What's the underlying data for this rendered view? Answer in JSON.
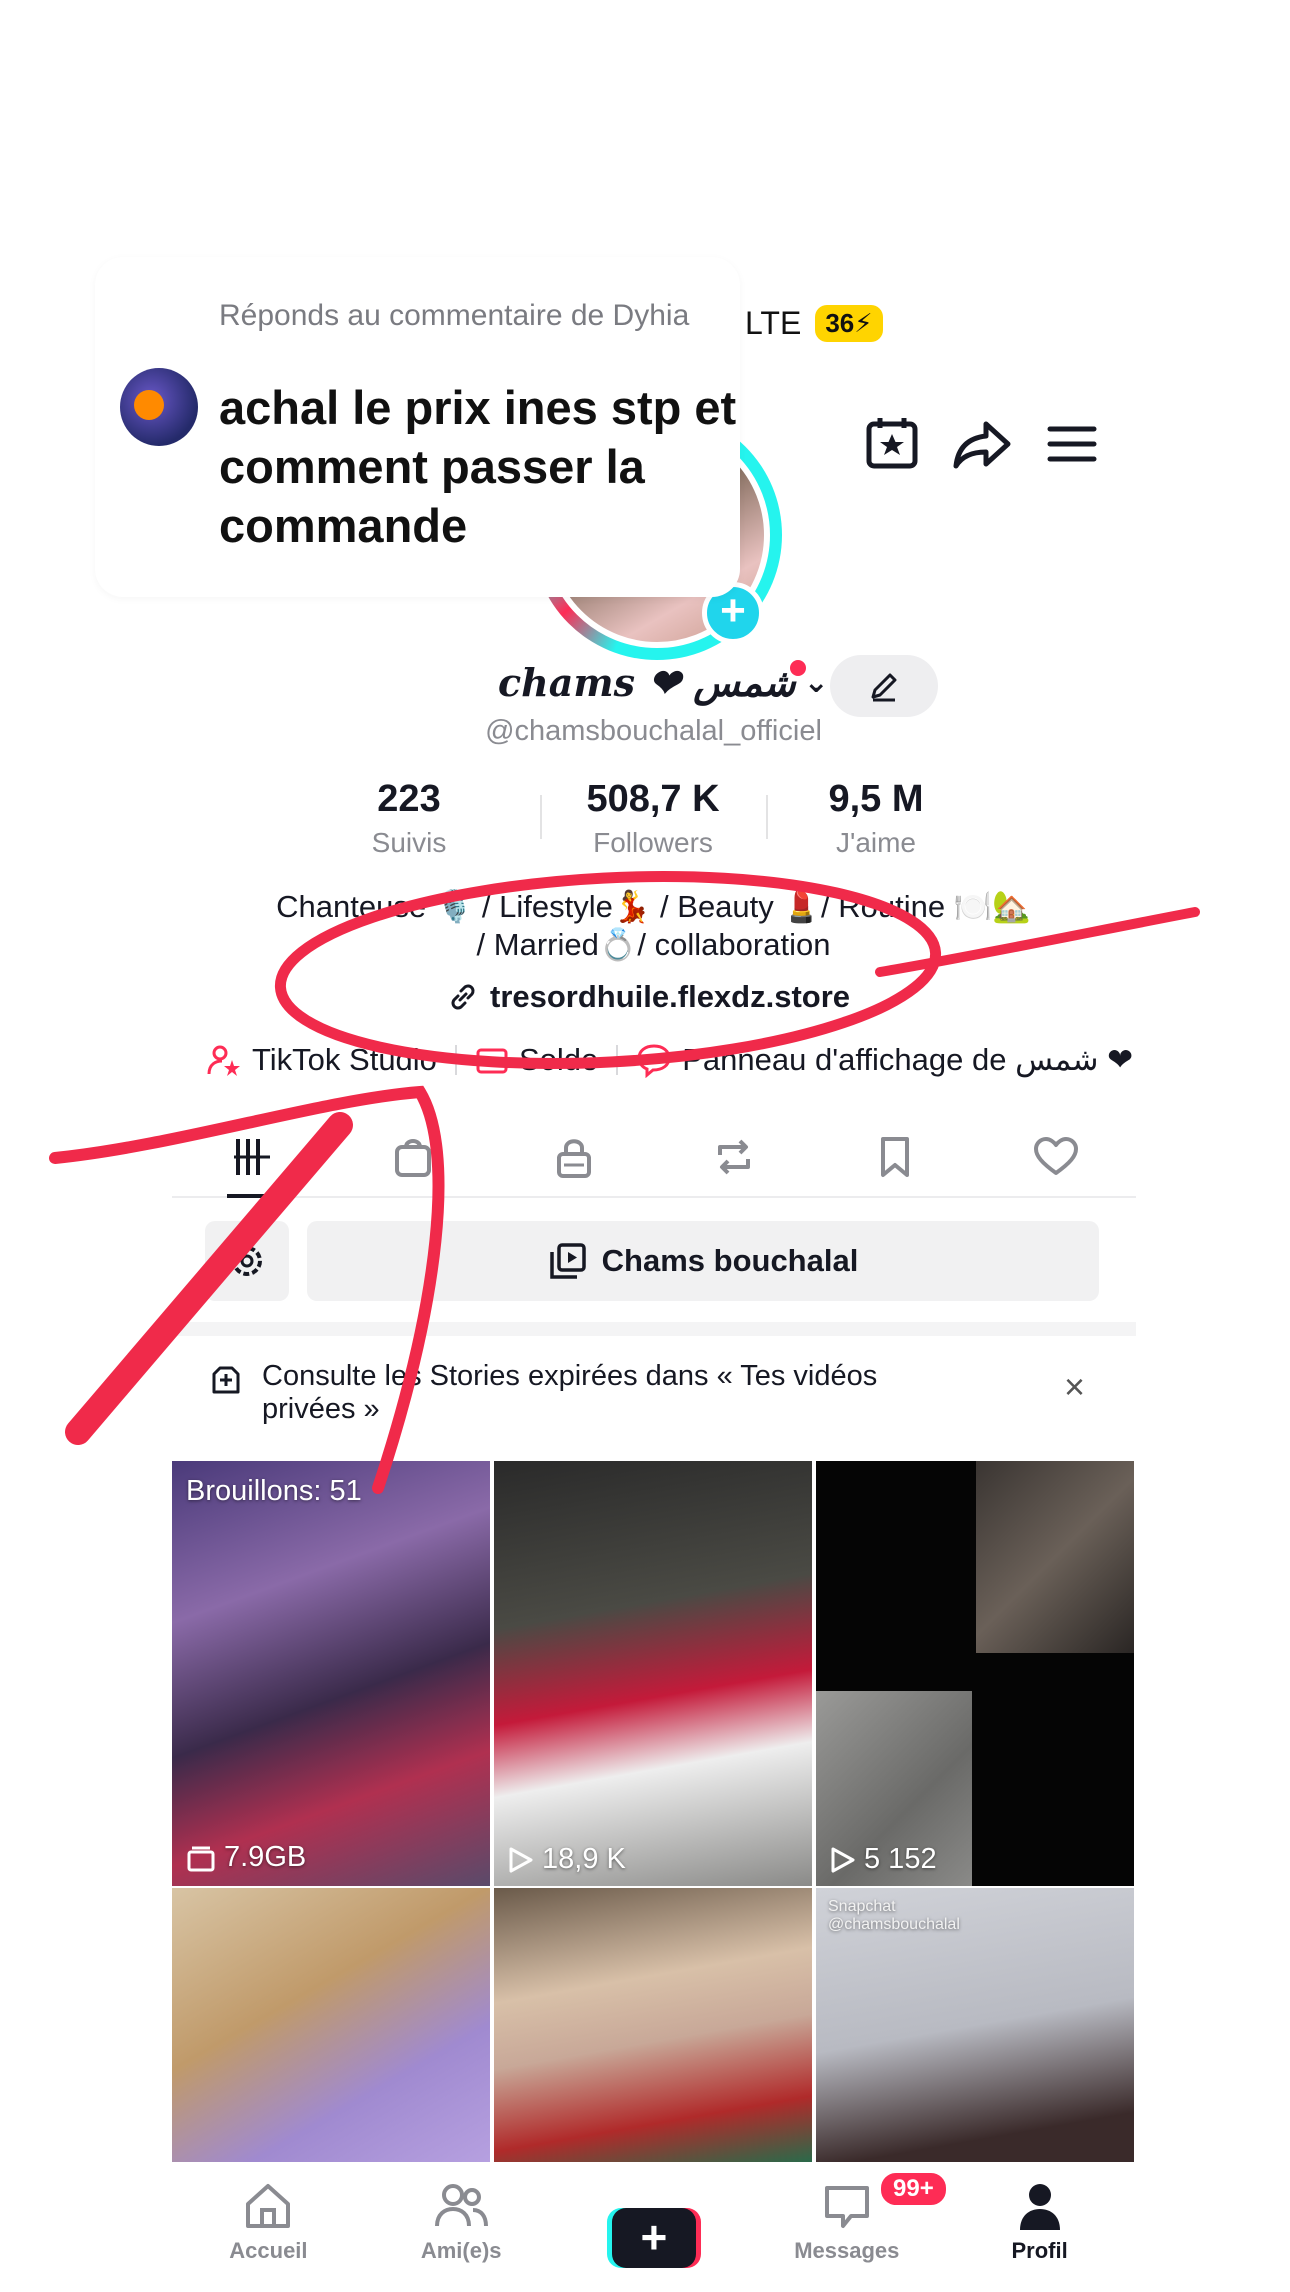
{
  "status_bar": {
    "network": "LTE",
    "battery": "36"
  },
  "comment_bubble": {
    "reply_to": "Réponds au commentaire de Dyhia",
    "text": "achal le prix ines stp et comment passer la commande"
  },
  "profile": {
    "display_name": "chams ❤ شمس",
    "handle": "@chamsbouchalal_officiel",
    "stats": [
      {
        "value": "223",
        "label": "Suivis"
      },
      {
        "value": "508,7 K",
        "label": "Followers"
      },
      {
        "value": "9,5 M",
        "label": "J'aime"
      }
    ],
    "bio_line1": "Chanteuse 🎙️ / Lifestyle💃 / Beauty 💄/ Routine 🍽️🏡",
    "bio_line2": "/ Married💍/ collaboration",
    "link": "tresordhuile.flexdz.store"
  },
  "quick_links": {
    "studio": "TikTok Studio",
    "balance": "Solde",
    "board": "Panneau d'affichage de شمس ❤"
  },
  "playlist_button": "Chams bouchalal",
  "banner": {
    "text": "Consulte les Stories expirées dans « Tes vidéos privées »",
    "close": "×"
  },
  "grid": {
    "drafts_label": "Brouillons: 51",
    "drafts_size": "7.9GB",
    "views": [
      "18,9 K",
      "5 152"
    ],
    "watermark": "Snapchat @chamsbouchalal"
  },
  "bottom_nav": {
    "home": "Accueil",
    "friends": "Ami(e)s",
    "create": "+",
    "messages": "Messages",
    "messages_badge": "99+",
    "profile": "Profil"
  },
  "colors": {
    "accent": "#fe2c55",
    "cyan": "#25f4ee",
    "text": "#161823",
    "muted": "#8a8b91"
  }
}
